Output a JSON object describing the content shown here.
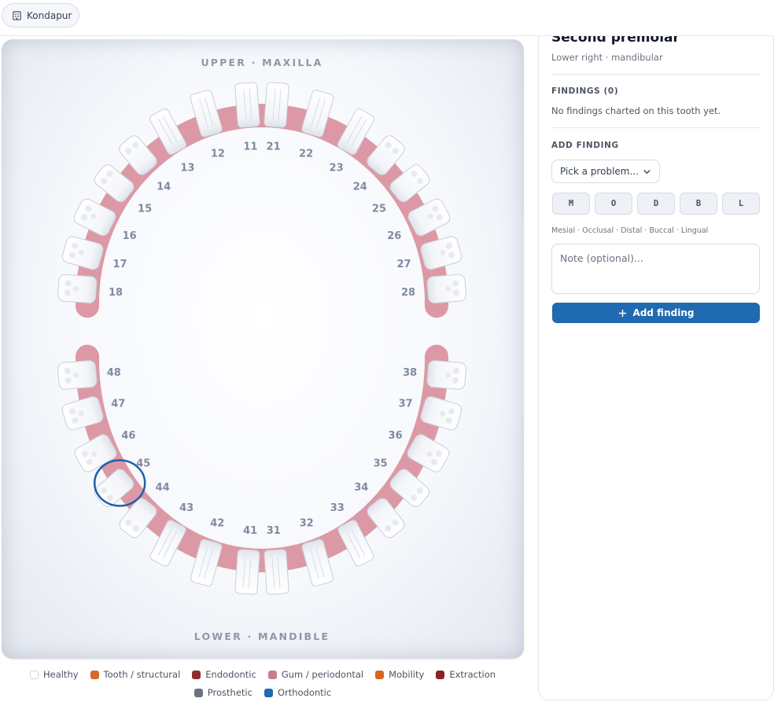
{
  "header": {
    "location_label": "Kondapur",
    "location_icon": "building-icon"
  },
  "chart": {
    "upper_title": "UPPER · MAXILLA",
    "lower_title": "LOWER · MANDIBLE",
    "selected_tooth": "45",
    "upper_teeth": [
      "18",
      "17",
      "16",
      "15",
      "14",
      "13",
      "12",
      "11",
      "21",
      "22",
      "23",
      "24",
      "25",
      "26",
      "27",
      "28"
    ],
    "lower_teeth": [
      "48",
      "47",
      "46",
      "45",
      "44",
      "43",
      "42",
      "41",
      "31",
      "32",
      "33",
      "34",
      "35",
      "36",
      "37",
      "38"
    ],
    "colors": {
      "gum": "#d88e9b",
      "tooth": "#fafbfd",
      "selection": "#1f5fa5"
    }
  },
  "legend": [
    {
      "label": "Healthy",
      "color": "#ffffff"
    },
    {
      "label": "Tooth / structural",
      "color": "#d9692b"
    },
    {
      "label": "Endodontic",
      "color": "#8f2c2c"
    },
    {
      "label": "Gum / periodontal",
      "color": "#c77d8a"
    },
    {
      "label": "Mobility",
      "color": "#d5661f"
    },
    {
      "label": "Extraction",
      "color": "#8a2525"
    },
    {
      "label": "Prosthetic",
      "color": "#6b7280"
    },
    {
      "label": "Orthodontic",
      "color": "#1f6ab0"
    }
  ],
  "panel": {
    "tooth_name": "Second premolar",
    "tooth_location": "Lower right · mandibular",
    "findings_heading": "FINDINGS (0)",
    "empty_message": "No findings charted on this tooth yet.",
    "add_heading": "ADD FINDING",
    "problem_placeholder": "Pick a problem...",
    "surfaces": [
      "M",
      "O",
      "D",
      "B",
      "L"
    ],
    "surface_hint": "Mesial · Occlusal · Distal · Buccal · Lingual",
    "note_placeholder": "Note (optional)...",
    "add_button": "Add finding"
  }
}
